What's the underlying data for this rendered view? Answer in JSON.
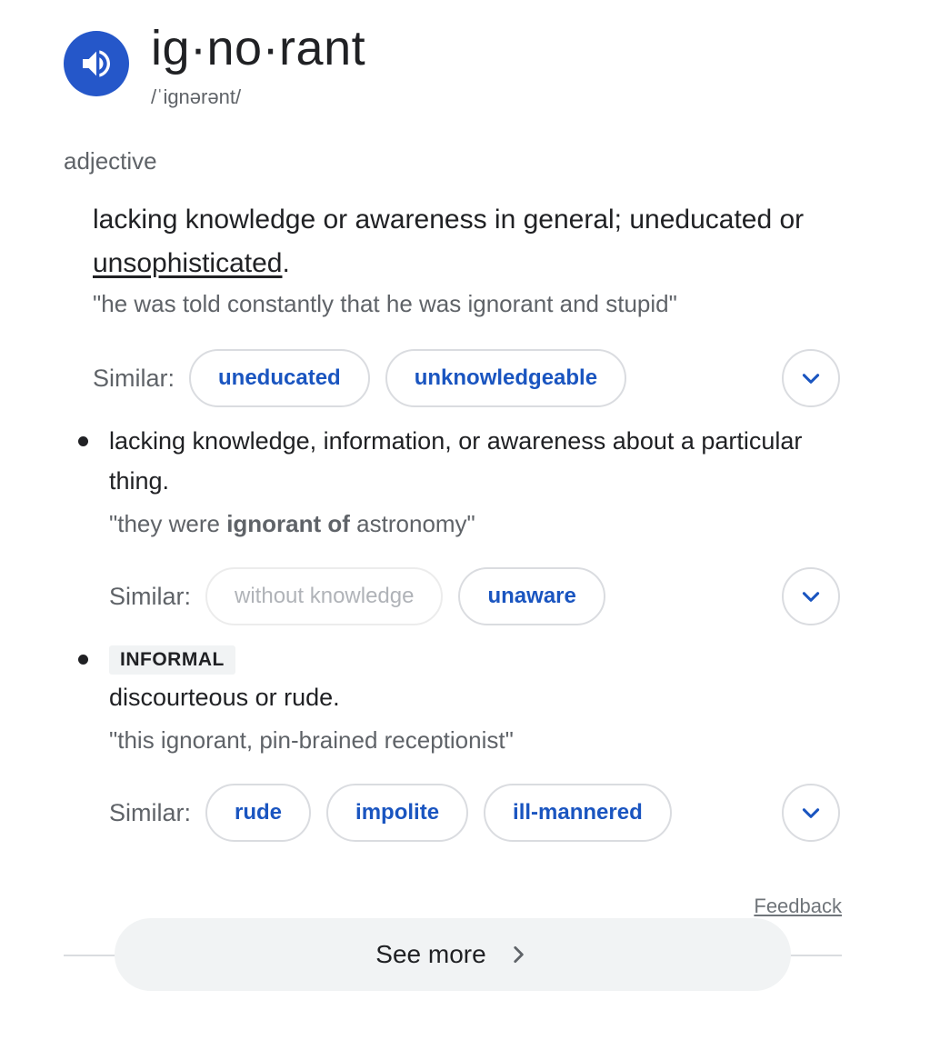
{
  "entry": {
    "word": "ig·no·rant",
    "pronunciation": "/ˈiɡnərənt/",
    "part_of_speech": "adjective"
  },
  "sense1": {
    "definition_before": "lacking knowledge or awareness in general; uneducated or ",
    "definition_link": "unsophisticated",
    "definition_after": ".",
    "example": "\"he was told constantly that he was ignorant and stupid\"",
    "similar_label": "Similar:",
    "similar": [
      "uneducated",
      "unknowledgeable"
    ]
  },
  "sense2": {
    "definition": "lacking knowledge, information, or awareness about a particular thing.",
    "example_before": "\"they were ",
    "example_bold": "ignorant of",
    "example_after": " astronomy\"",
    "similar_label": "Similar:",
    "similar": [
      "without knowledge",
      "unaware"
    ]
  },
  "sense3": {
    "tag": "INFORMAL",
    "definition": "discourteous or rude.",
    "example": "\"this ignorant, pin-brained receptionist\"",
    "similar_label": "Similar:",
    "similar": [
      "rude",
      "impolite",
      "ill-mannered"
    ]
  },
  "footer": {
    "feedback": "Feedback",
    "see_more": "See more"
  },
  "colors": {
    "accent": "#2557c9",
    "chip_text": "#1a55c0",
    "muted_text": "#5f6368"
  }
}
